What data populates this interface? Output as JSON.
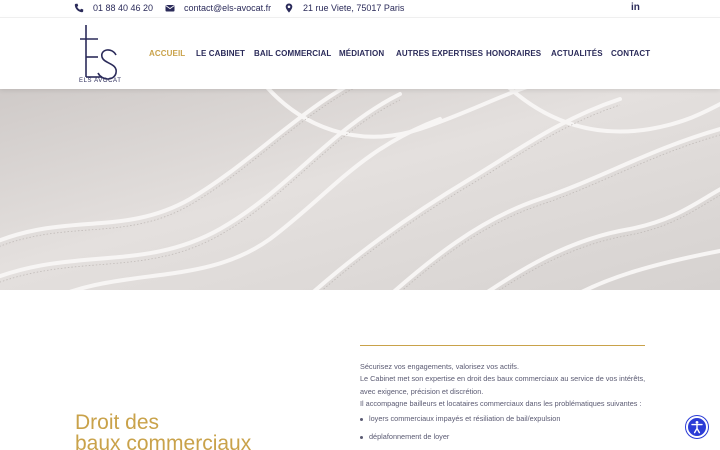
{
  "topbar": {
    "phone": "01 88 40 46 20",
    "email": "contact@els-avocat.fr",
    "address": "21 rue Viete, 75017 Paris",
    "social": "in"
  },
  "header": {
    "logo_text": "ELS AVOCAT",
    "nav": [
      {
        "label": "ACCUEIL",
        "active": true
      },
      {
        "label": "LE CABINET",
        "active": false
      },
      {
        "label": "BAIL COMMERCIAL",
        "active": false
      },
      {
        "label": "MÉDIATION",
        "active": false
      },
      {
        "label": "AUTRES EXPERTISES",
        "active": false
      },
      {
        "label": "HONORAIRES",
        "active": false
      },
      {
        "label": "ACTUALITÉS",
        "active": false
      },
      {
        "label": "CONTACT",
        "active": false
      }
    ]
  },
  "main": {
    "title_line1": "Droit des",
    "title_line2": "baux commerciaux",
    "intro_lines": [
      "Sécurisez vos engagements, valorisez vos actifs.",
      "Le Cabinet met son expertise en droit des baux commerciaux au service de vos intérêts, avec exigence, précision et discrétion.",
      "Il accompagne bailleurs et locataires commerciaux dans les problématiques suivantes :"
    ],
    "bullets": [
      "loyers commerciaux impayés et résiliation de bail/expulsion",
      "déplafonnement de loyer"
    ]
  },
  "colors": {
    "accent": "#c9a24a",
    "navy": "#2b2b5a",
    "accessibility": "#2a3bd6"
  },
  "icons": {
    "phone": "phone-icon",
    "email": "envelope-icon",
    "address": "map-pin-icon",
    "social": "linkedin-icon",
    "accessibility": "accessibility-icon"
  }
}
